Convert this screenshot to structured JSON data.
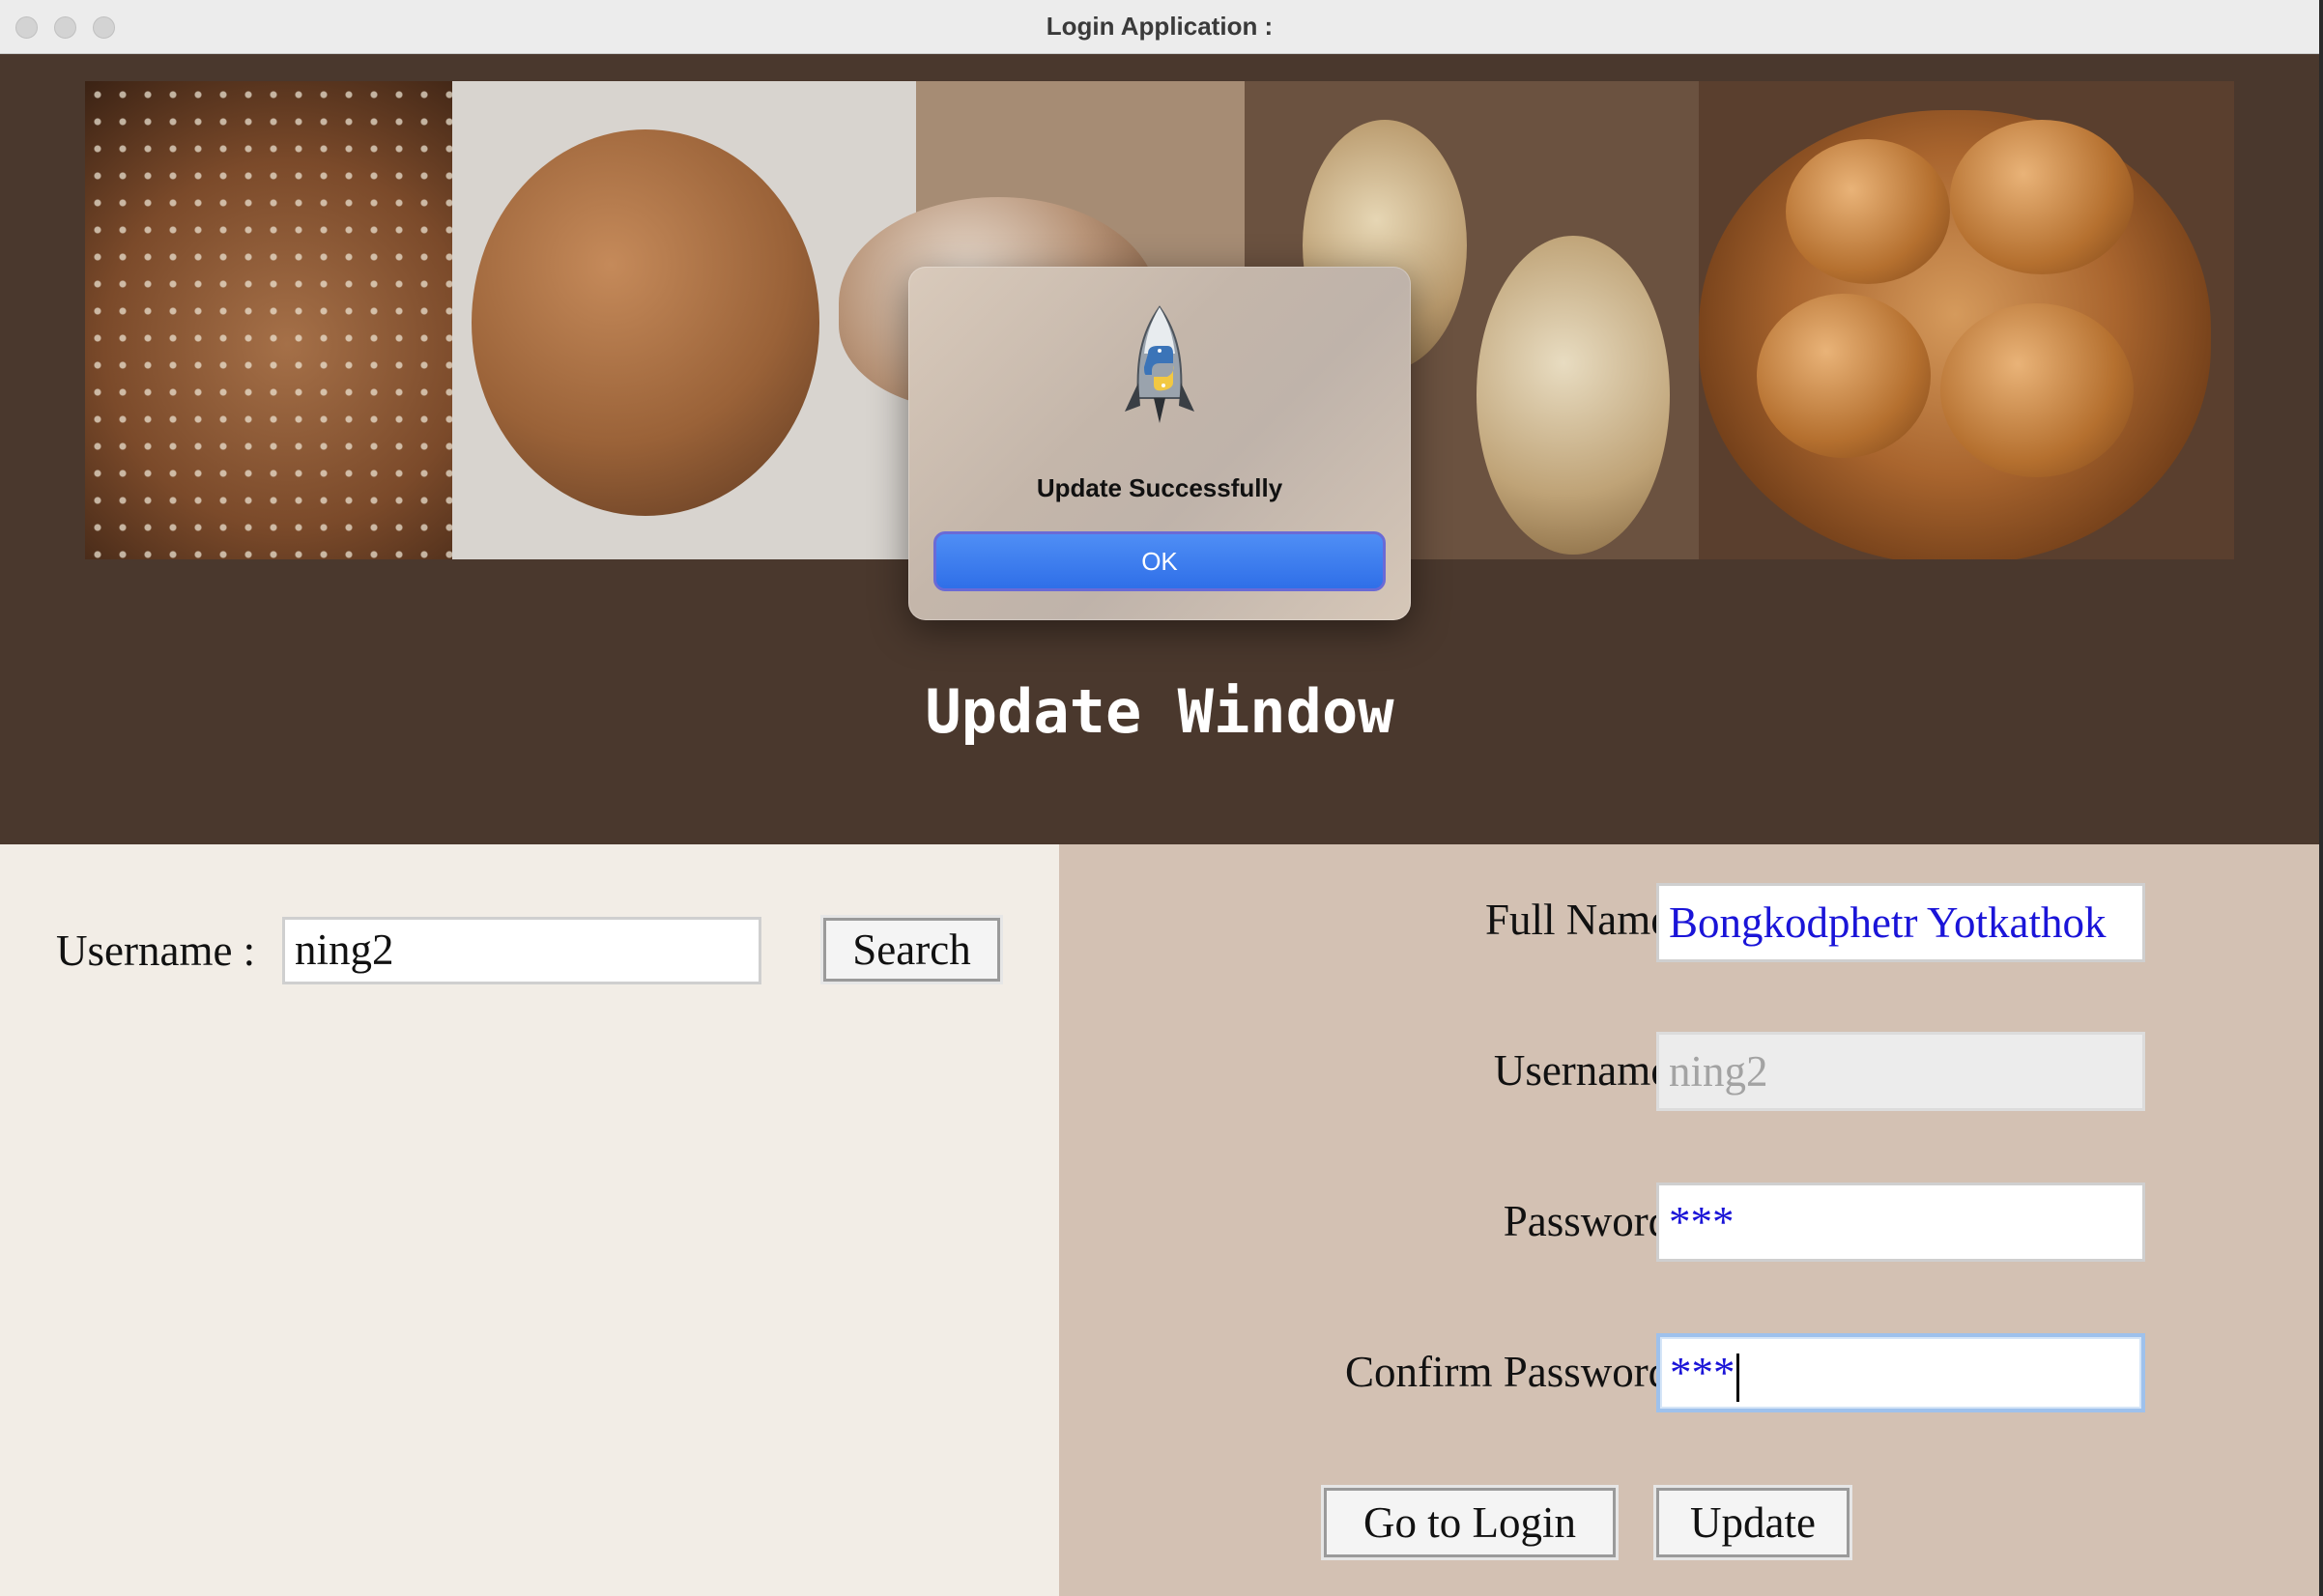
{
  "window": {
    "title": "Login Application :"
  },
  "heading": "Update Window",
  "search": {
    "username_label": "Username :",
    "username_value": "ning2",
    "search_label": "Search"
  },
  "form": {
    "fullname_label": "Full Name :",
    "fullname_value": "Bongkodphetr Yotkathok",
    "username_label": "Username :",
    "username_value": "ning2",
    "password_label": "Password :",
    "password_value": "***",
    "confirm_label": "Confirm Password :",
    "confirm_value": "***",
    "goto_login_label": "Go to Login",
    "update_label": "Update"
  },
  "dialog": {
    "icon": "python-launcher-rocket-icon",
    "message": "Update Successfully",
    "ok_label": "OK"
  },
  "colors": {
    "header_bg": "#4a382d",
    "left_panel_bg": "#f2ede6",
    "right_panel_bg": "#d3c1b3",
    "input_text_blue": "#1a14d8",
    "ok_button_blue": "#3b7bf0"
  }
}
